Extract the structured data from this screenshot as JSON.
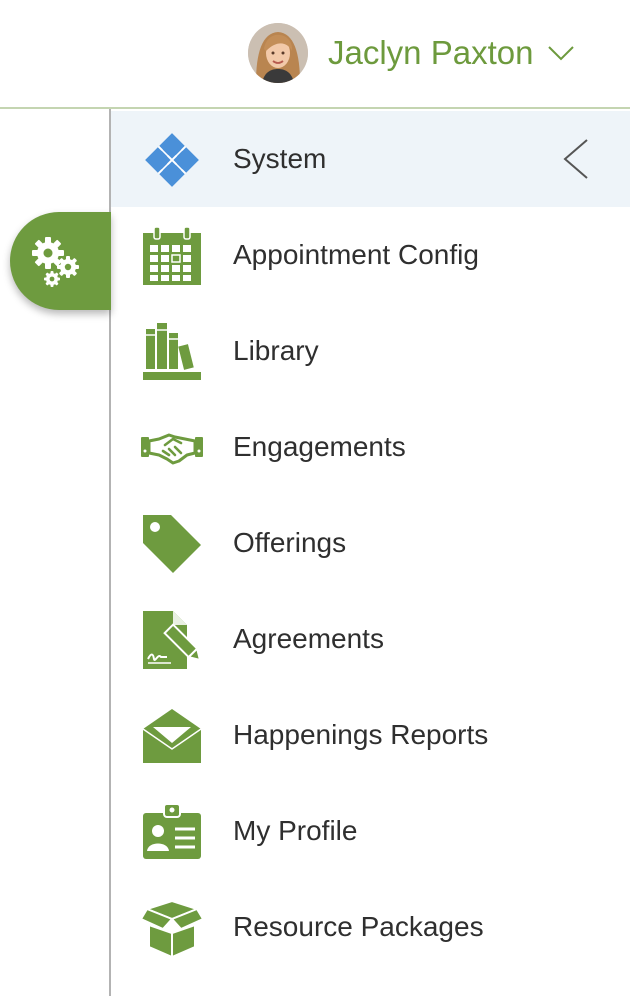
{
  "user": {
    "name": "Jaclyn Paxton",
    "avatar_icon": "user-avatar-photo",
    "menu_icon": "chevron-down-icon"
  },
  "colors": {
    "accent": "#6e9b3f",
    "user_name": "#6d9a3d",
    "active_bg": "#eef4f9",
    "system_icon": "#4a90d9"
  },
  "tab": {
    "icon": "gears-icon"
  },
  "menu": {
    "collapse_icon": "chevron-left-icon",
    "items": [
      {
        "label": "System",
        "icon": "puzzle-icon",
        "active": true
      },
      {
        "label": "Appointment Config",
        "icon": "calendar-icon"
      },
      {
        "label": "Library",
        "icon": "books-icon"
      },
      {
        "label": "Engagements",
        "icon": "handshake-icon"
      },
      {
        "label": "Offerings",
        "icon": "tag-icon"
      },
      {
        "label": "Agreements",
        "icon": "signed-document-icon"
      },
      {
        "label": "Happenings Reports",
        "icon": "envelope-icon"
      },
      {
        "label": "My Profile",
        "icon": "id-badge-icon"
      },
      {
        "label": "Resource Packages",
        "icon": "open-box-icon"
      }
    ]
  }
}
